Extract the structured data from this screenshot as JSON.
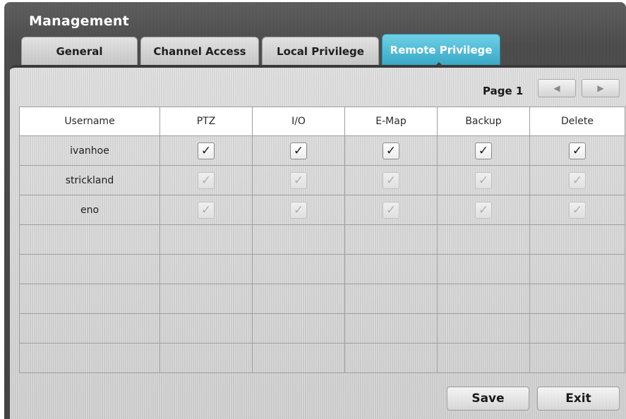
{
  "window": {
    "title": "Management"
  },
  "tabs": [
    {
      "label": "General",
      "active": false
    },
    {
      "label": "Channel Access",
      "active": false
    },
    {
      "label": "Local Privilege",
      "active": false
    },
    {
      "label": "Remote Privilege",
      "active": true
    }
  ],
  "pagination": {
    "label": "Page 1",
    "prev_icon": "triangle-left-icon",
    "next_icon": "triangle-right-icon"
  },
  "table": {
    "columns": [
      "Username",
      "PTZ",
      "I/O",
      "E-Map",
      "Backup",
      "Delete"
    ],
    "rows": [
      {
        "username": "ivanhoe",
        "checks": [
          true,
          true,
          true,
          true,
          true
        ],
        "enabled": true
      },
      {
        "username": "strickland",
        "checks": [
          true,
          true,
          true,
          true,
          true
        ],
        "enabled": false
      },
      {
        "username": "eno",
        "checks": [
          true,
          true,
          true,
          true,
          true
        ],
        "enabled": false
      }
    ],
    "empty_rows": 5
  },
  "buttons": {
    "save": "Save",
    "exit": "Exit"
  }
}
